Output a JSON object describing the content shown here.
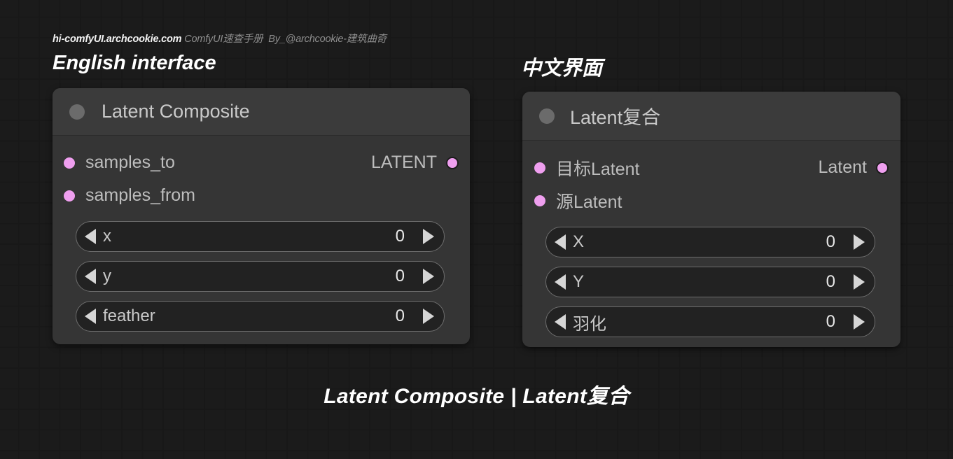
{
  "credit": {
    "site": "hi-comfyUI.archcookie.com",
    "manual": "ComfyUI速查手册",
    "author": "By_@archcookie-建筑曲奇"
  },
  "headings": {
    "english": "English interface",
    "chinese": "中文界面"
  },
  "colors": {
    "accent_port": "#ef9fef",
    "node_body": "#353535",
    "node_title": "#3b3b3b",
    "canvas": "#1b1b1b"
  },
  "nodes": {
    "english": {
      "title": "Latent Composite",
      "inputs": [
        {
          "label": "samples_to"
        },
        {
          "label": "samples_from"
        }
      ],
      "outputs": [
        {
          "label": "LATENT"
        }
      ],
      "widgets": [
        {
          "label": "x",
          "value": "0"
        },
        {
          "label": "y",
          "value": "0"
        },
        {
          "label": "feather",
          "value": "0"
        }
      ]
    },
    "chinese": {
      "title": "Latent复合",
      "inputs": [
        {
          "label": "目标Latent"
        },
        {
          "label": "源Latent"
        }
      ],
      "outputs": [
        {
          "label": "Latent"
        }
      ],
      "widgets": [
        {
          "label": "X",
          "value": "0"
        },
        {
          "label": "Y",
          "value": "0"
        },
        {
          "label": "羽化",
          "value": "0"
        }
      ]
    }
  },
  "caption": "Latent Composite | Latent复合"
}
